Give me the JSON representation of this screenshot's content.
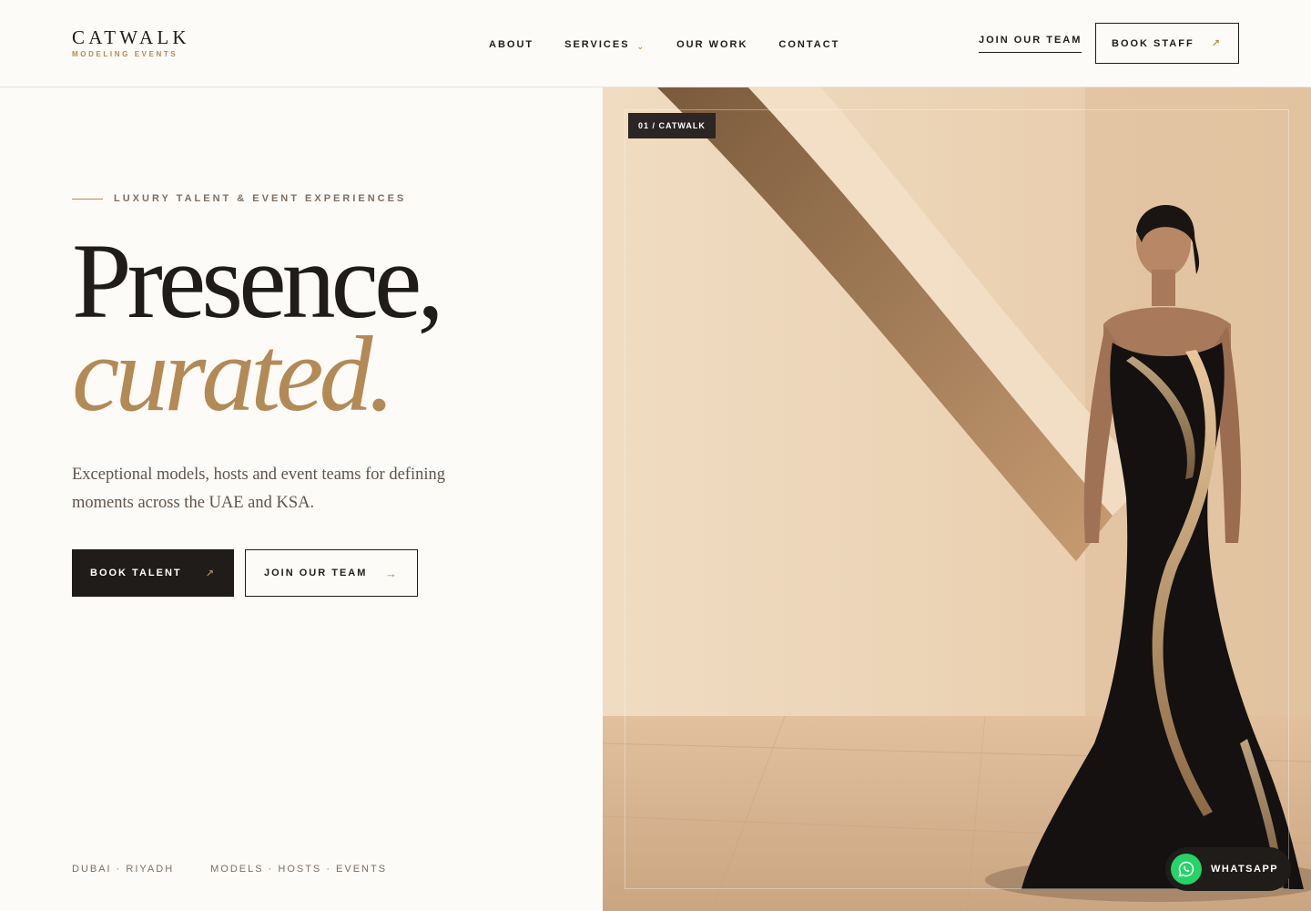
{
  "brand": {
    "name": "CATWALK",
    "tagline": "MODELING EVENTS"
  },
  "nav": {
    "items": [
      {
        "label": "ABOUT"
      },
      {
        "label": "SERVICES"
      },
      {
        "label": "OUR WORK"
      },
      {
        "label": "CONTACT"
      }
    ],
    "join_label": "JOIN OUR TEAM",
    "book_label": "BOOK STAFF"
  },
  "hero": {
    "eyebrow": "LUXURY TALENT & EVENT EXPERIENCES",
    "headline_line1": "Presence,",
    "headline_line2": "curated.",
    "lede": "Exceptional models, hosts and event teams for defining moments across the UAE and KSA.",
    "cta_primary": "BOOK TALENT",
    "cta_secondary": "JOIN OUR TEAM",
    "meta_locations": "DUBAI · RIYADH",
    "meta_services": "MODELS · HOSTS · EVENTS"
  },
  "media": {
    "tag": "01 / CATWALK"
  },
  "whatsapp": {
    "label": "WHATSAPP"
  },
  "colors": {
    "accent": "#b38a55",
    "ink": "#1f1c1a",
    "background": "#fcfbf8",
    "whatsapp": "#25d366"
  }
}
